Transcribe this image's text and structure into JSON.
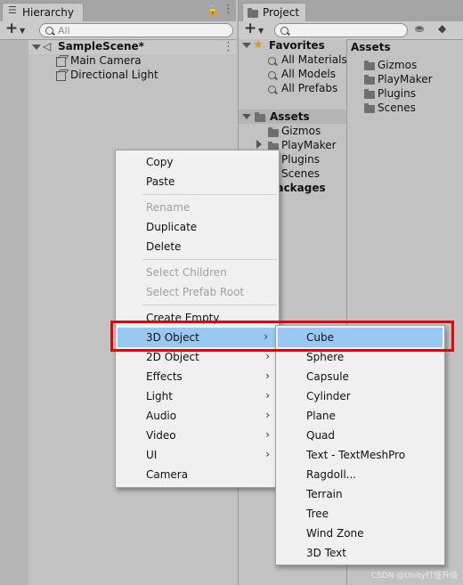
{
  "hierarchy": {
    "tab_title": "Hierarchy",
    "add_label": "+",
    "search_placeholder": "All",
    "scene_name": "SampleScene*",
    "items": [
      "Main Camera",
      "Directional Light"
    ]
  },
  "project": {
    "tab_title": "Project",
    "add_label": "+",
    "favorites_title": "Favorites",
    "favorites": [
      "All Materials",
      "All Models",
      "All Prefabs"
    ],
    "assets_title": "Assets",
    "assets_tree": [
      "Gizmos",
      "PlayMaker",
      "Plugins",
      "Scenes"
    ],
    "packages_title": "Packages",
    "right_header": "Assets",
    "right_items": [
      "Gizmos",
      "PlayMaker",
      "Plugins",
      "Scenes"
    ]
  },
  "context_menu": {
    "items": [
      {
        "label": "Copy",
        "disabled": false
      },
      {
        "label": "Paste",
        "disabled": false
      },
      {
        "label": "Rename",
        "disabled": true
      },
      {
        "label": "Duplicate",
        "disabled": false
      },
      {
        "label": "Delete",
        "disabled": false
      },
      {
        "label": "Select Children",
        "disabled": true
      },
      {
        "label": "Select Prefab Root",
        "disabled": true
      },
      {
        "label": "Create Empty",
        "disabled": false
      },
      {
        "label": "3D Object",
        "disabled": false,
        "submenu": true,
        "highlighted": true
      },
      {
        "label": "2D Object",
        "disabled": false,
        "submenu": true
      },
      {
        "label": "Effects",
        "disabled": false,
        "submenu": true
      },
      {
        "label": "Light",
        "disabled": false,
        "submenu": true
      },
      {
        "label": "Audio",
        "disabled": false,
        "submenu": true
      },
      {
        "label": "Video",
        "disabled": false,
        "submenu": true
      },
      {
        "label": "UI",
        "disabled": false,
        "submenu": true
      },
      {
        "label": "Camera",
        "disabled": false
      }
    ],
    "submenu_arrow": "›"
  },
  "submenu_3d": {
    "items": [
      "Cube",
      "Sphere",
      "Capsule",
      "Cylinder",
      "Plane",
      "Quad",
      "Text - TextMeshPro",
      "Ragdoll...",
      "Terrain",
      "Tree",
      "Wind Zone",
      "3D Text"
    ],
    "highlighted": "Cube"
  },
  "watermark": "CSDN @Unity打怪升级",
  "colors": {
    "highlight": "#99c9f3",
    "annotation_red": "#e0070b",
    "panel_bg": "#c2c2c2",
    "menu_bg": "#f0f0f0"
  }
}
